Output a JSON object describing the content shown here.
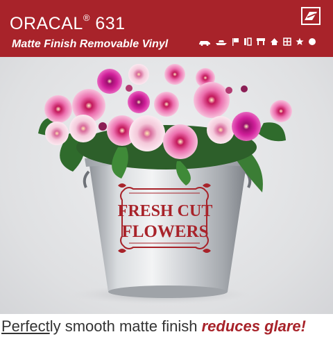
{
  "header": {
    "brand": "ORACAL",
    "registered": "®",
    "model": "631",
    "subtitle": "Matte Finish Removable Vinyl",
    "logo_icon": "brand-logo-icon",
    "application_icons": [
      "car-icon",
      "boat-icon",
      "flag-icon",
      "window-icon",
      "awning-icon",
      "house-icon",
      "grid-icon",
      "star-icon",
      "circle-icon"
    ]
  },
  "product": {
    "sign_line1": "FRESH CUT",
    "sign_line2": "FLOWERS"
  },
  "footer": {
    "caption_underlined": "Perfect",
    "caption_plain": "ly smooth matte finish ",
    "caption_emphasis": "reduces glare!"
  },
  "colors": {
    "brand_red": "#a8232a",
    "white": "#ffffff",
    "text_dark": "#333333",
    "background": "#e4e5e7"
  }
}
